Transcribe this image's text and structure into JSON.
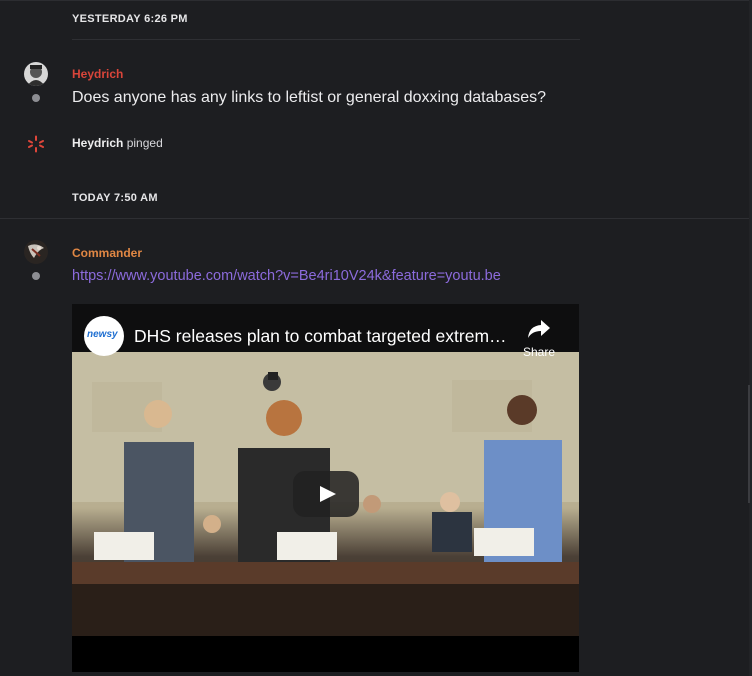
{
  "separators": {
    "yesterday": "YESTERDAY 6:26 PM",
    "today": "TODAY 7:50 AM"
  },
  "messages": [
    {
      "author": "Heydrich",
      "author_color": "#d9453a",
      "text": "Does anyone has any links to leftist or general doxxing databases?"
    },
    {
      "author": "Commander",
      "author_color": "#e08744",
      "link": "https://www.youtube.com/watch?v=Be4ri10V24k&feature=youtu.be"
    }
  ],
  "ping": {
    "actor": "Heydrich",
    "action": "pinged"
  },
  "embed": {
    "channel_logo_text": "newsy",
    "title": "DHS releases plan to combat targeted extrem…",
    "share_label": "Share",
    "icons": [
      "share-icon",
      "play-icon"
    ]
  },
  "colors": {
    "background": "#1d1e21",
    "link": "#8c6bdc",
    "heydrich": "#d9453a",
    "commander": "#e08744"
  }
}
